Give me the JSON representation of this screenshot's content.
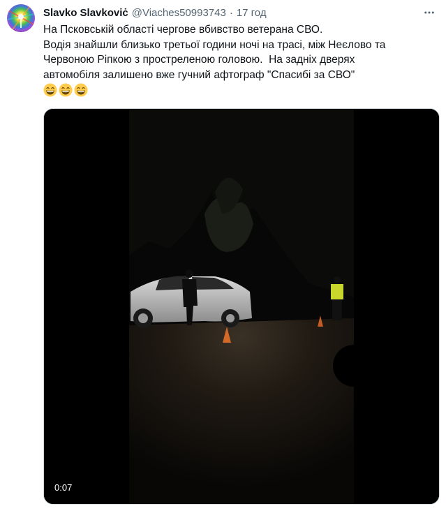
{
  "author": {
    "display_name": "Slavko Slavkoviċ",
    "handle": "@Viaches50993743",
    "separator": "·",
    "time": "17 год"
  },
  "tweet": {
    "lines": [
      "На Псковській області чергове вбивство ветерана СВО.",
      "Водія знайшли близько третьої години ночі на трасі, між Неєлово та",
      "Червоною Ріпкою з простреленою головою.  На задніх дверях",
      "автомобіля залишено вже гучний афтограф \"Спасибі за СВО\""
    ],
    "emojis": [
      "grinning-face-with-smiling-eyes",
      "grinning-face-with-smiling-eyes",
      "grinning-face-with-smiling-eyes"
    ]
  },
  "media": {
    "type": "video",
    "duration": "0:07"
  },
  "icons": {
    "more": "more-horizontal-icon",
    "avatar": "rainbow-avatar"
  },
  "colors": {
    "secondary_text": "#536471",
    "primary_text": "#0f1419",
    "media_border": "#cfd9de"
  }
}
